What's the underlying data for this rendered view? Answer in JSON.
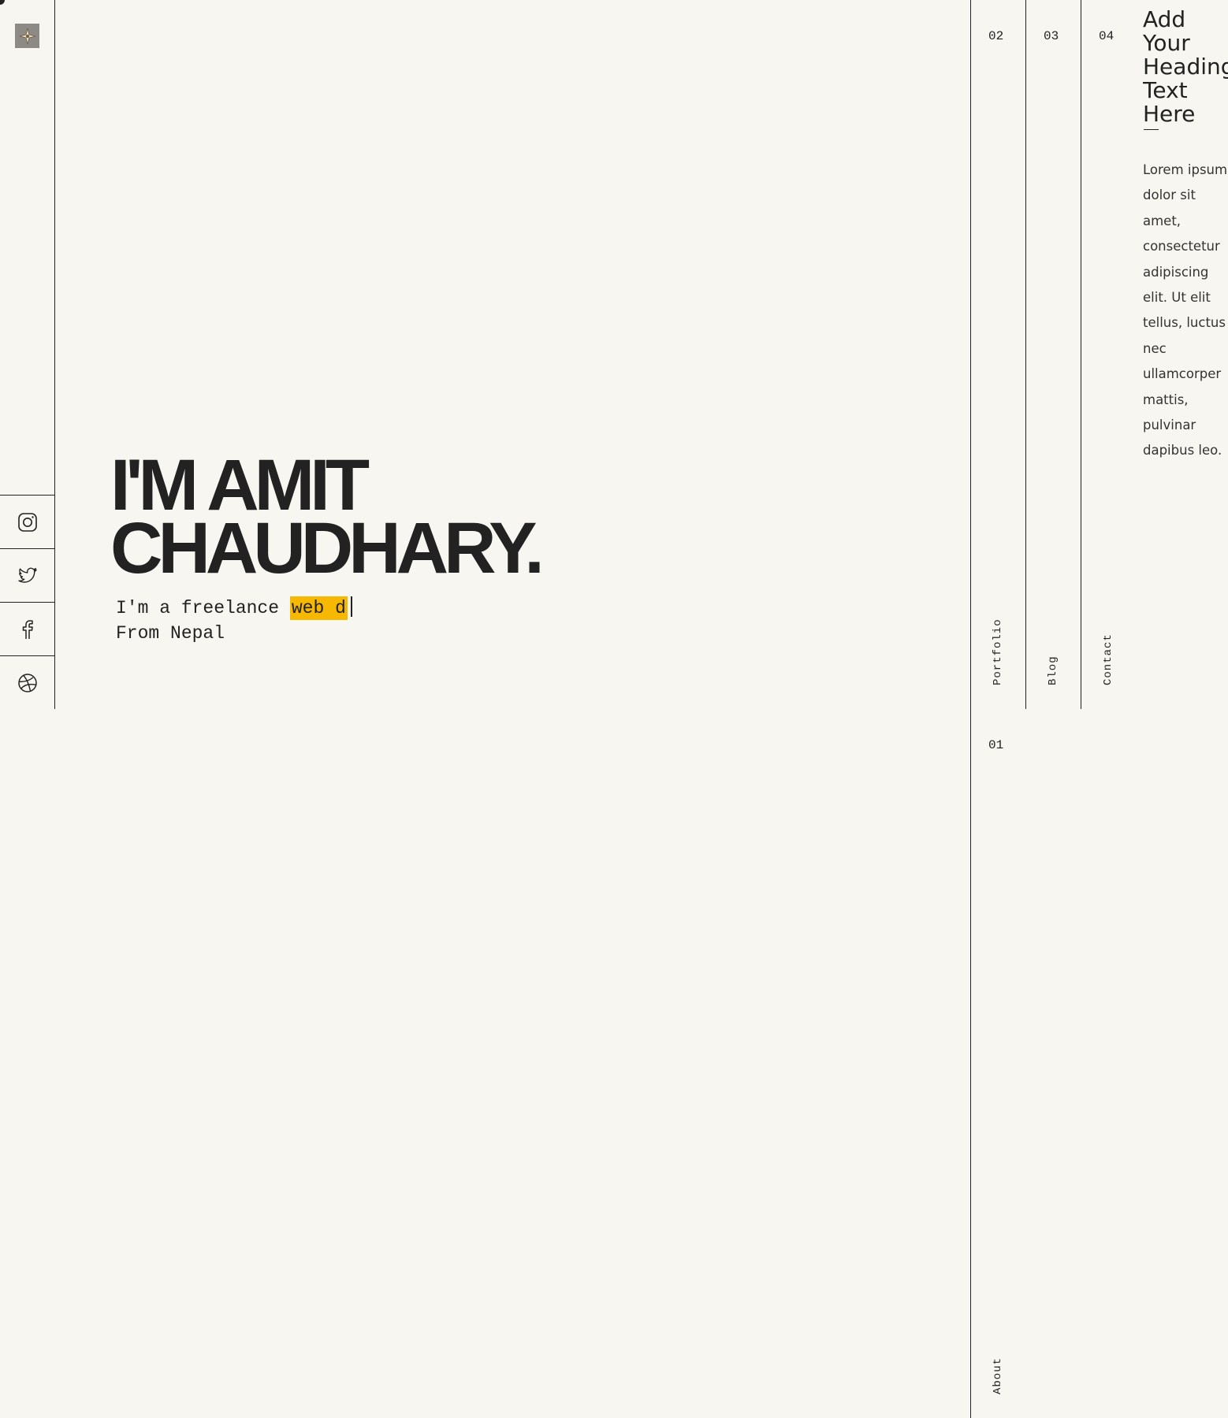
{
  "hero": {
    "name_line1": "I'M AMIT",
    "name_line2": "CHAUDHARY.",
    "tagline_prefix": "I'm a freelance",
    "tagline_highlight": "web d",
    "tagline_line2": "From Nepal"
  },
  "social": [
    {
      "icon": "instagram-icon"
    },
    {
      "icon": "twitter-icon"
    },
    {
      "icon": "facebook-icon"
    },
    {
      "icon": "dribbble-icon"
    }
  ],
  "nav": {
    "portfolio": {
      "num": "02",
      "label": "Portfolio"
    },
    "blog": {
      "num": "03",
      "label": "Blog"
    },
    "contact": {
      "num": "04",
      "label": "Contact"
    },
    "about": {
      "num": "01",
      "label": "About"
    }
  },
  "sidebar": {
    "heading": "Add Your Heading Text Here",
    "body": "Lorem ipsum dolor sit amet, consectetur adipiscing elit. Ut elit tellus, luctus nec ullamcorper mattis, pulvinar dapibus leo."
  },
  "colors": {
    "background": "#f7f6f1",
    "text": "#222222",
    "highlight": "#f6b800",
    "logo_tile": "#8d8985"
  }
}
